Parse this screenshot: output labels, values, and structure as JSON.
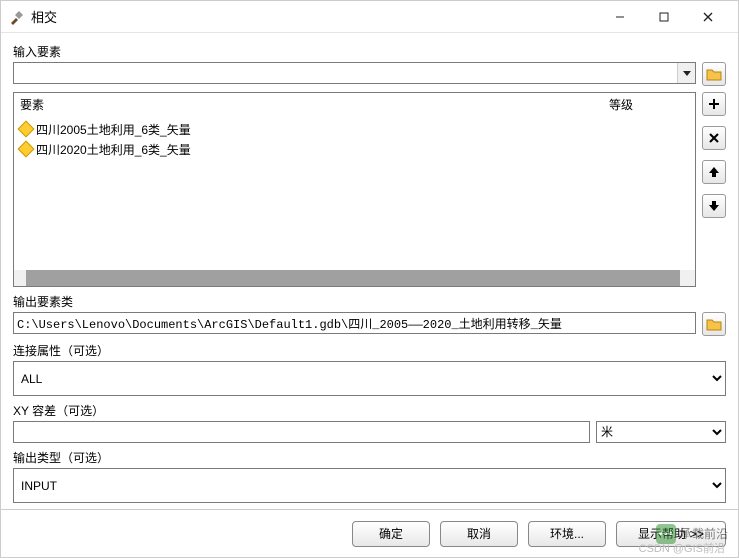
{
  "window": {
    "title": "相交"
  },
  "labels": {
    "input_features": "输入要素",
    "col_feature": "要素",
    "col_rank": "等级",
    "output_fc": "输出要素类",
    "join_attr": "连接属性（可选）",
    "xy_tol": "XY 容差（可选）",
    "output_type": "输出类型（可选）"
  },
  "features": [
    {
      "name": "四川2005土地利用_6类_矢量"
    },
    {
      "name": "四川2020土地利用_6类_矢量"
    }
  ],
  "output_path": "C:\\Users\\Lenovo\\Documents\\ArcGIS\\Default1.gdb\\四川_2005——2020_土地利用转移_矢量",
  "join_attr_value": "ALL",
  "xy_tol_value": "",
  "xy_unit": "米",
  "output_type_value": "INPUT",
  "buttons": {
    "ok": "确定",
    "cancel": "取消",
    "env": "环境...",
    "help": "显示帮助"
  },
  "watermark": {
    "text": "承载前沿",
    "csdn": "CSDN @GIS前沿"
  }
}
